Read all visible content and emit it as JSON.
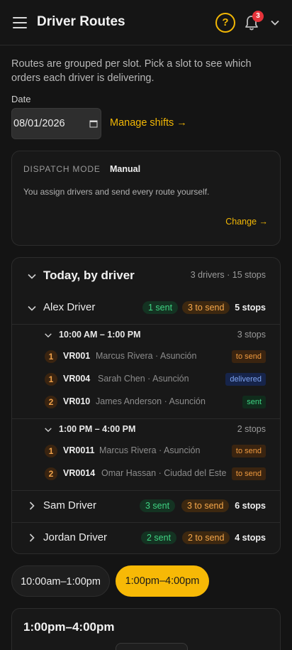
{
  "header": {
    "title": "Driver Routes",
    "help_icon": "?",
    "notification_count": "3"
  },
  "intro_text": "Routes are grouped per slot. Pick a slot to see which orders each driver is delivering.",
  "date": {
    "label": "Date",
    "value": "08/01/2026"
  },
  "manage_shifts_label": "Manage shifts →",
  "dispatch": {
    "label": "DISPATCH MODE",
    "mode": "Manual",
    "description": "You assign drivers and send every route yourself.",
    "change_label": "Change →"
  },
  "today": {
    "title": "Today, by driver",
    "summary": "3 drivers · 15 stops",
    "drivers": [
      {
        "name": "Alex Driver",
        "sent": "1 sent",
        "to_send": "3 to send",
        "stops": "5 stops",
        "expanded": true,
        "slots": [
          {
            "time": "10:00 AM – 1:00 PM",
            "stops": "3 stops",
            "orders": [
              {
                "seq": "1",
                "code": "VR001",
                "detail": "Marcus Rivera · Asunción",
                "status": "to send"
              },
              {
                "seq": "1",
                "code": "VR004",
                "detail": "Sarah Chen · Asunción",
                "status": "delivered"
              },
              {
                "seq": "2",
                "code": "VR010",
                "detail": "James Anderson · Asunción",
                "status": "sent"
              }
            ]
          },
          {
            "time": "1:00 PM – 4:00 PM",
            "stops": "2 stops",
            "orders": [
              {
                "seq": "1",
                "code": "VR0011",
                "detail": "Marcus Rivera · Asunción",
                "status": "to send"
              },
              {
                "seq": "2",
                "code": "VR0014",
                "detail": "Omar Hassan · Ciudad del Este",
                "status": "to send"
              }
            ]
          }
        ]
      },
      {
        "name": "Sam Driver",
        "sent": "3 sent",
        "to_send": "3 to send",
        "stops": "6 stops",
        "expanded": false
      },
      {
        "name": "Jordan Driver",
        "sent": "2 sent",
        "to_send": "2 to send",
        "stops": "4 stops",
        "expanded": false
      }
    ]
  },
  "slot_tabs": [
    {
      "label": "10:00am–1:00pm",
      "selected": false
    },
    {
      "label": "1:00pm–4:00pm",
      "selected": true
    }
  ],
  "selected_slot_title": "1:00pm–4:00pm",
  "colors": {
    "accent": "#f7b906",
    "sent_green": "#3fd483",
    "to_send_orange": "#f09a3e",
    "delivered_blue": "#7da3f0",
    "badge_red": "#e5333a"
  }
}
